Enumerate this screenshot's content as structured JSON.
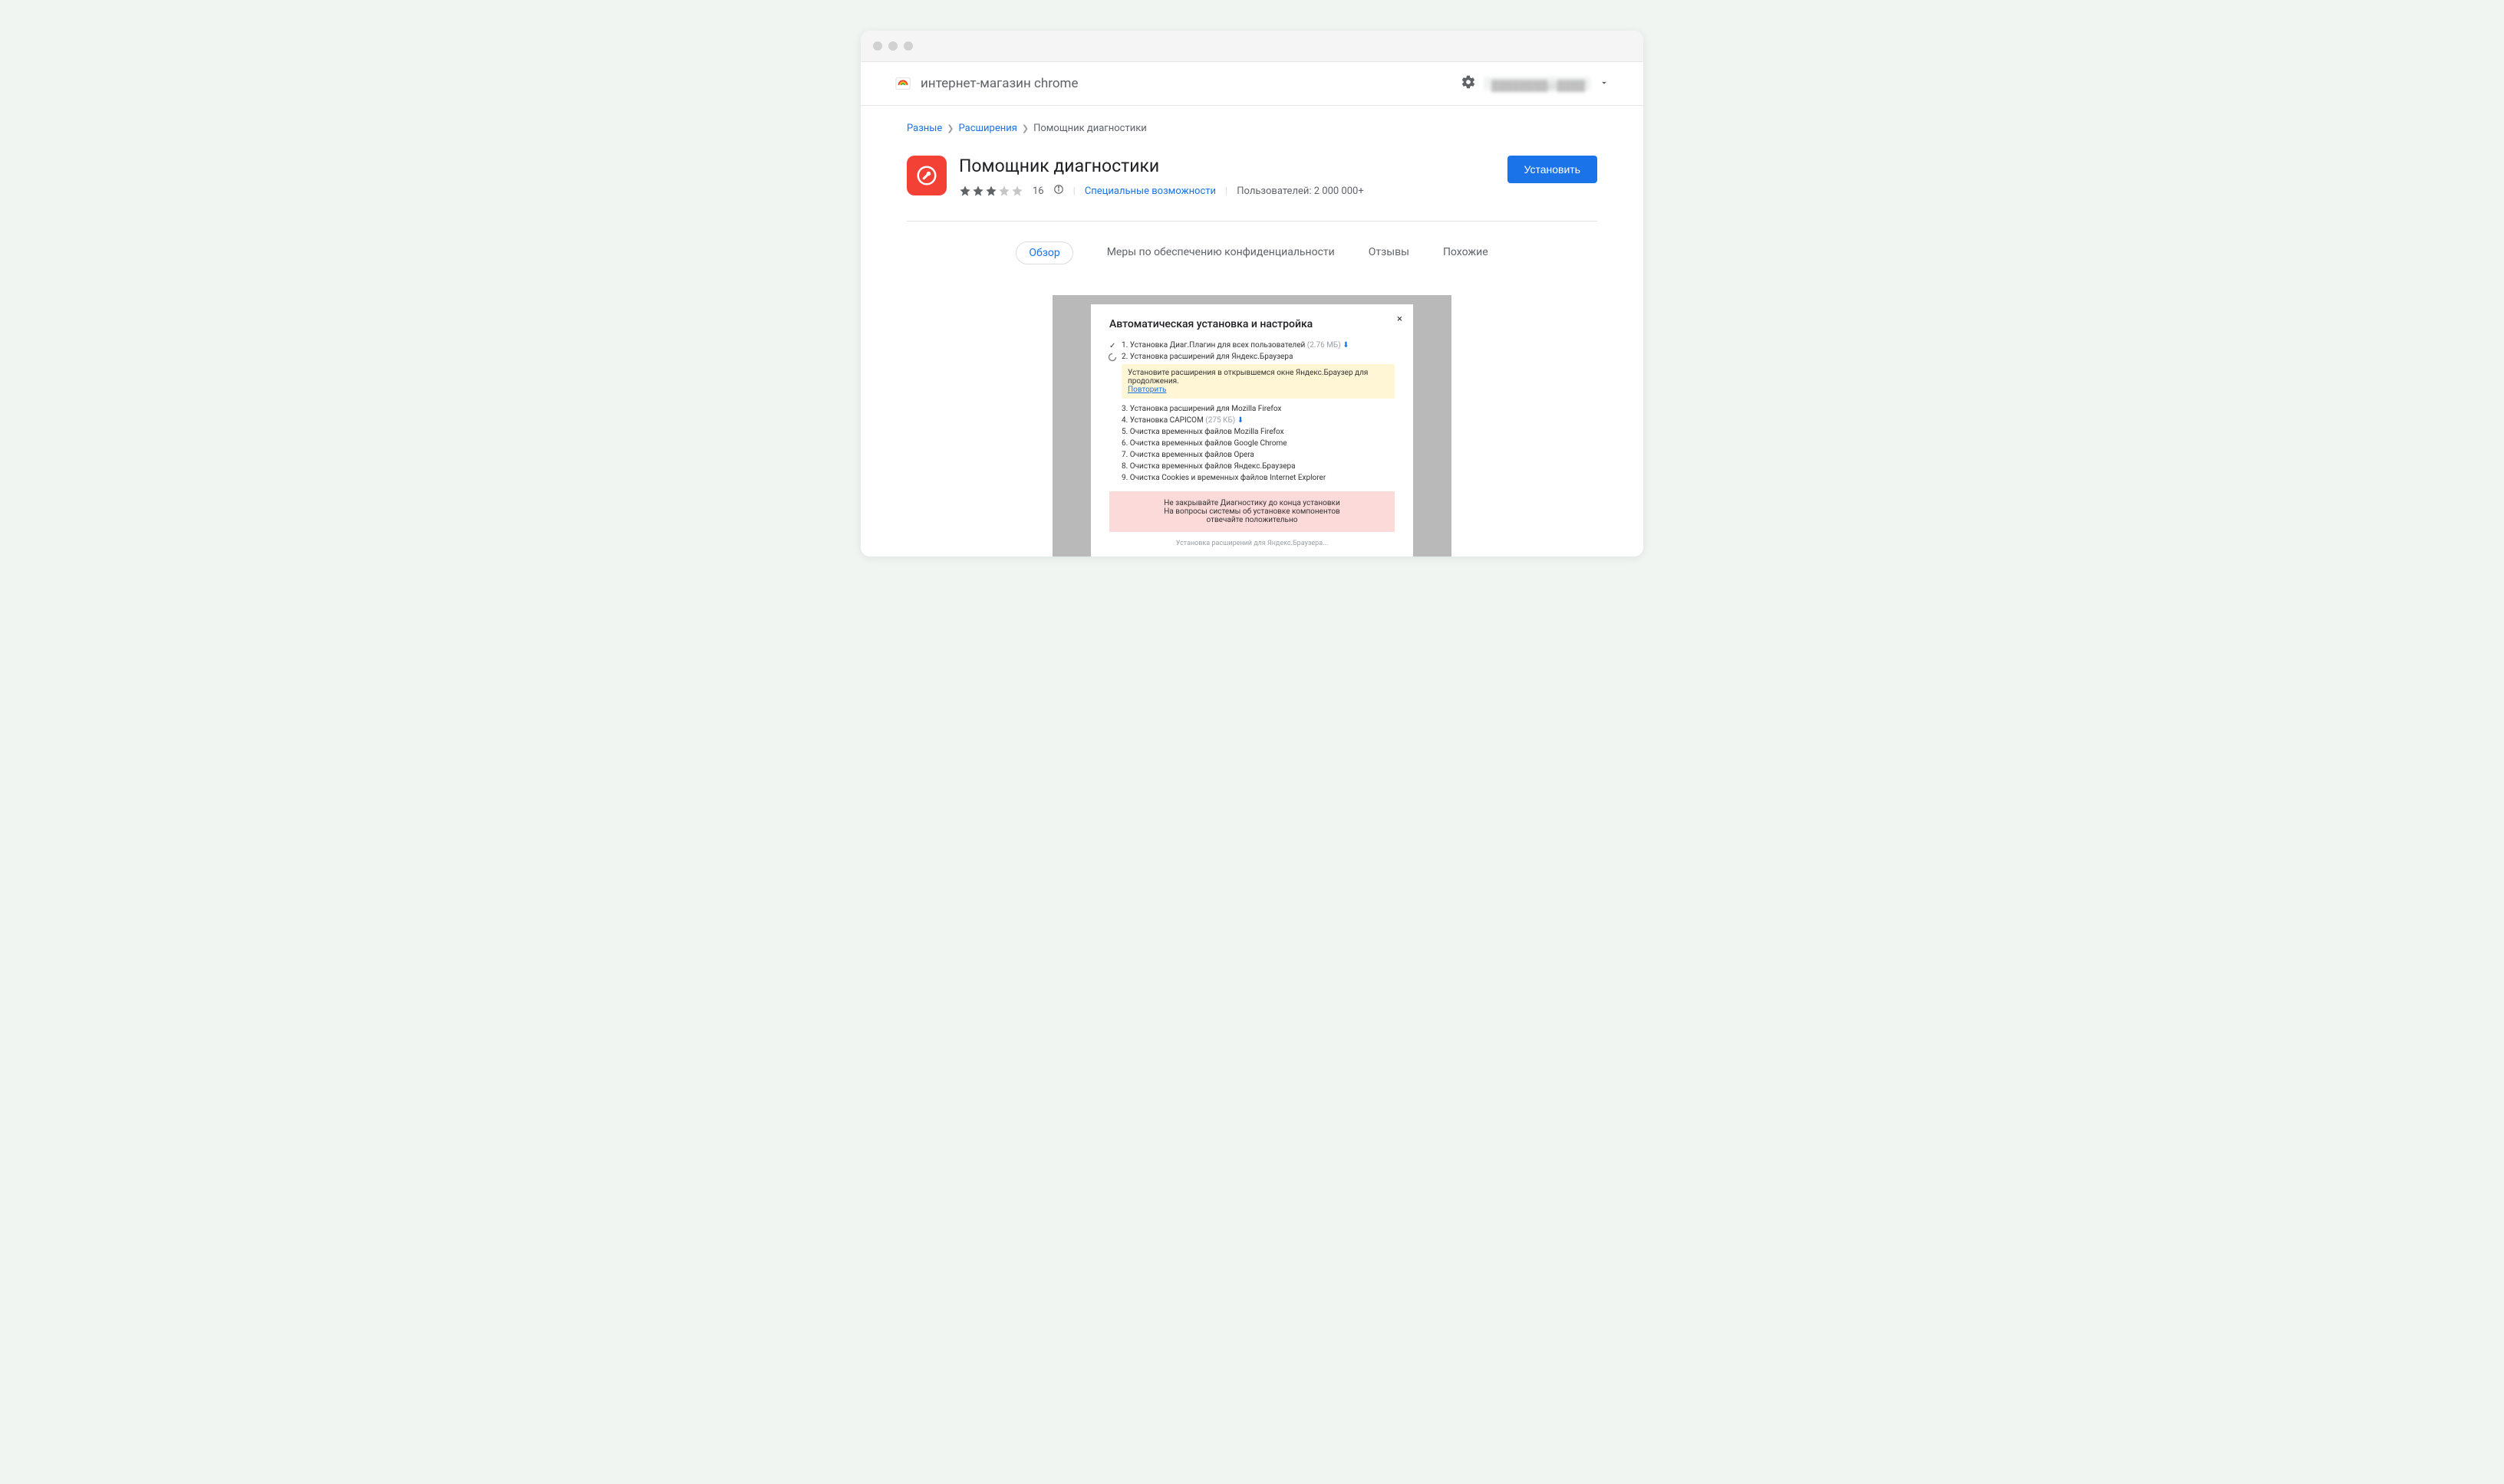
{
  "header": {
    "store_title": "интернет-магазин chrome",
    "user_display": "████████@████"
  },
  "breadcrumb": {
    "root": "Разные",
    "section": "Расширения",
    "current": "Помощник диагностики"
  },
  "extension": {
    "name": "Помощник диагностики",
    "rating_count": "16",
    "category_label": "Специальные возможности",
    "users_label": "Пользователей: 2 000 000+",
    "install_label": "Установить"
  },
  "tabs": {
    "overview": "Обзор",
    "privacy": "Меры по обеспечению конфиденциальности",
    "reviews": "Отзывы",
    "related": "Похожие"
  },
  "screenshot": {
    "modal_title": "Автоматическая установка и настройка",
    "close": "×",
    "step1_text": "1. Установка Диаг.Плагин для всех пользователей",
    "step1_size": "(2.76 МБ)",
    "step2_text": "2. Установка расширений для Яндекс.Браузера",
    "yellow_text": "Установите расширения в открывшемся окне Яндекс.Браузер для продолжения.",
    "yellow_link": "Повторить",
    "step3": "3. Установка расширений для Mozilla Firefox",
    "step4_text": "4. Установка CAPICOM",
    "step4_size": "(275 КБ)",
    "step5": "5. Очистка временных файлов Mozilla Firefox",
    "step6": "6. Очистка временных файлов Google Chrome",
    "step7": "7. Очистка временных файлов Opera",
    "step8": "8. Очистка временных файлов Яндекс.Браузера",
    "step9": "9. Очистка Cookies и временных файлов Internet Explorer",
    "pink_line1": "Не закрывайте Диагностику до конца установки",
    "pink_line2": "На вопросы системы об установке компонентов",
    "pink_line3": "отвечайте положительно",
    "footer": "Установка расширений для Яндекс.Браузера..."
  }
}
